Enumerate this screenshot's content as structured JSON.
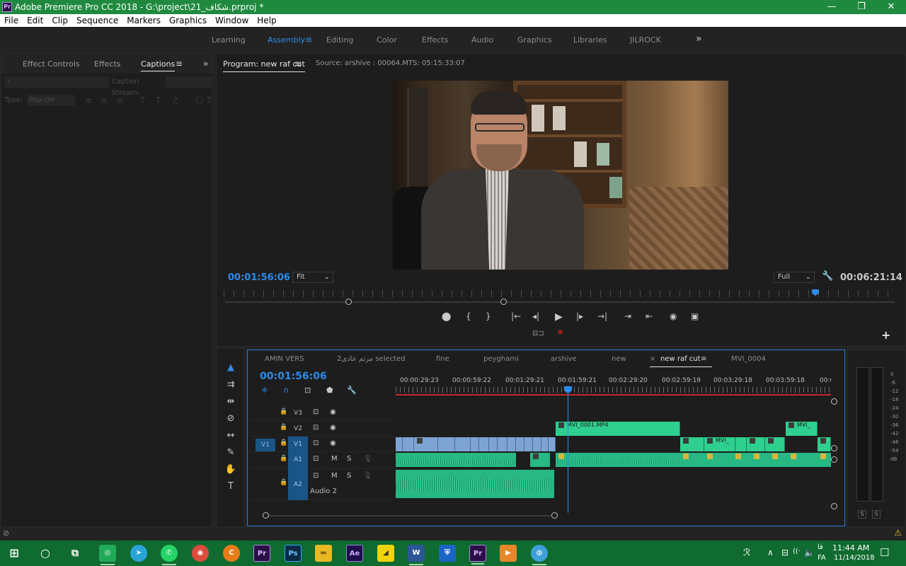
{
  "titlebar": {
    "app_icon": "Pr",
    "title": "Adobe Premiere Pro CC 2018 - G:\\project\\21_شکاف.prproj *",
    "minimize": "—",
    "maximize": "❐",
    "close": "✕"
  },
  "menu": [
    "File",
    "Edit",
    "Clip",
    "Sequence",
    "Markers",
    "Graphics",
    "Window",
    "Help"
  ],
  "workspaces": {
    "items": [
      "Learning",
      "Assembly",
      "Editing",
      "Color",
      "Effects",
      "Audio",
      "Graphics",
      "Libraries",
      "JILROCK"
    ],
    "active": "Assembly",
    "menu_glyph": "≡",
    "more_glyph": "»"
  },
  "left_panel": {
    "tabs": [
      "Effect Controls",
      "Effects",
      "Captions"
    ],
    "active_tab": "Captions",
    "menu_glyph": "≡",
    "more_glyph": "»",
    "search_icon": "⌕",
    "caption_stream_label": "Caption Stream:",
    "type_label": "Type:",
    "type_value": "Pop-On",
    "format_glyphs": [
      "≡",
      "≡",
      "≡",
      "T",
      "T",
      "♫",
      "☐",
      "T"
    ]
  },
  "program_monitor": {
    "tab_label": "Program: new raf cut",
    "menu_glyph": "≡",
    "source_label": "Source: arshive : 00064.MTS: 05:15:33:07",
    "current_timecode": "00:01:56:06",
    "zoom_value": "Fit",
    "quality_value": "Full",
    "duration_timecode": "00:06:21:14",
    "playhead_position": 0.878,
    "transport_glyphs": [
      "⬤",
      "{",
      "}",
      "|←",
      "◂|",
      "▶",
      "|▸",
      "→|",
      "⇥",
      "⇤",
      "◉",
      "▣"
    ],
    "add_glyph": "+",
    "accent_color": "#2d8ceb"
  },
  "tools": [
    "select-tool",
    "track-select-tool",
    "ripple-edit-tool",
    "razor-tool",
    "slip-tool",
    "pen-tool",
    "hand-tool",
    "type-tool"
  ],
  "tool_glyphs": [
    "▲",
    "⇉",
    "⇹",
    "⊘",
    "↔",
    "✎",
    "✋",
    "T"
  ],
  "timeline": {
    "tabs": [
      "AMIN VERS",
      "2مرتم عادی selected",
      "fine",
      "peyghami",
      "arshive",
      "new",
      "new raf cut",
      "MVI_0004"
    ],
    "active_tab": "new raf cut",
    "close_glyph": "×",
    "menu_glyph": "≡",
    "timecode": "00:01:56:06",
    "tool_glyphs": [
      "⁜",
      "∩",
      "⊡",
      "⬟",
      "🔧"
    ],
    "ruler_labels": [
      "00:00:29:23",
      "00:00:59:22",
      "00:01:29:21",
      "00:01:59:21",
      "00:02:29:20",
      "00:02:59:19",
      "00:03:29:18",
      "00:03:59:18",
      "00:0"
    ],
    "tracks": [
      {
        "name": "V3",
        "type": "video",
        "target": "",
        "selected": false
      },
      {
        "name": "V2",
        "type": "video",
        "target": "",
        "selected": false
      },
      {
        "name": "V1",
        "type": "video",
        "target": "V1",
        "selected": true
      },
      {
        "name": "A1",
        "type": "audio",
        "target": "",
        "selected": true
      },
      {
        "name": "A2",
        "type": "audio",
        "target": "",
        "selected": true,
        "label": "Audio 2"
      }
    ],
    "track_icon_glyphs": {
      "lock": "🔒",
      "sync": "⊡",
      "eye": "◉",
      "mute": "M",
      "solo": "S",
      "mic": "🎙"
    },
    "clips": {
      "v2_first": "MVI_0001.MP4",
      "v2_last": "MVI_",
      "v1_green_2": "MVI_"
    }
  },
  "audio_meter": {
    "scale": [
      "0",
      "-6",
      "-12",
      "-18",
      "-24",
      "-30",
      "-36",
      "-42",
      "-48",
      "-54",
      "dB"
    ],
    "solo_labels": [
      "S",
      "S"
    ]
  },
  "statusbar": {
    "left_icon": "⊘",
    "warning_icon": "⚠"
  },
  "taskbar": {
    "apps": [
      {
        "name": "windows",
        "glyph": "⊞",
        "color": "transparent"
      },
      {
        "name": "cortana",
        "glyph": "○",
        "color": "transparent"
      },
      {
        "name": "task-view",
        "glyph": "⧉",
        "color": "transparent"
      },
      {
        "name": "camtasia",
        "glyph": "◎",
        "color": "#1faa59"
      },
      {
        "name": "telegram",
        "glyph": "➤",
        "color": "#2aa3d8"
      },
      {
        "name": "whatsapp",
        "glyph": "✆",
        "color": "#25d366"
      },
      {
        "name": "chrome",
        "glyph": "◉",
        "color": "#dd4b3e"
      },
      {
        "name": "ccleaner",
        "glyph": "C",
        "color": "#e97c1a"
      },
      {
        "name": "premiere",
        "glyph": "Pr",
        "color": "#2d0d47"
      },
      {
        "name": "photoshop",
        "glyph": "Ps",
        "color": "#0c2a45"
      },
      {
        "name": "explorer",
        "glyph": "▬",
        "color": "#e8b923"
      },
      {
        "name": "after-effects",
        "glyph": "Ae",
        "color": "#1f0e4a"
      },
      {
        "name": "sticky-notes",
        "glyph": "◢",
        "color": "#f2d40e"
      },
      {
        "name": "word",
        "glyph": "W",
        "color": "#2b5797"
      },
      {
        "name": "defender",
        "glyph": "⛨",
        "color": "#1b65c7"
      },
      {
        "name": "premiere-active",
        "glyph": "Pr",
        "color": "#2d0d47"
      },
      {
        "name": "media-player",
        "glyph": "▶",
        "color": "#e8872a"
      },
      {
        "name": "network-app",
        "glyph": "◍",
        "color": "#3da0d8"
      }
    ],
    "tray_glyphs": [
      "ℛ",
      "∧",
      "⊟",
      "((·",
      "🔈"
    ],
    "language": "FA",
    "language_script": "فا",
    "time": "11:44 AM",
    "date": "11/14/2018",
    "notification_glyph": "☐"
  }
}
